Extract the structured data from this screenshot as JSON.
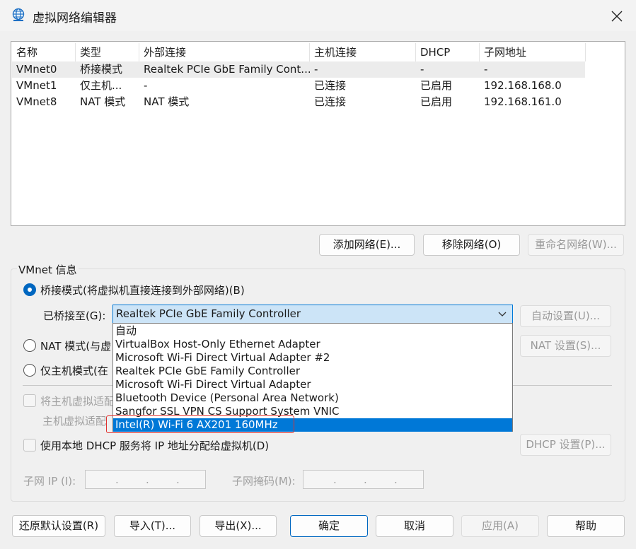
{
  "window": {
    "title": "虚拟网络编辑器",
    "icon": "globe-network-icon",
    "close_icon": "close-icon"
  },
  "network_list": {
    "columns": [
      "名称",
      "类型",
      "外部连接",
      "主机连接",
      "DHCP",
      "子网地址"
    ],
    "rows": [
      {
        "name": "VMnet0",
        "type": "桥接模式",
        "external": "Realtek PCIe GbE Family Cont...",
        "host": "-",
        "dhcp": "-",
        "subnet": "-"
      },
      {
        "name": "VMnet1",
        "type": "仅主机...",
        "external": "-",
        "host": "已连接",
        "dhcp": "已启用",
        "subnet": "192.168.168.0"
      },
      {
        "name": "VMnet8",
        "type": "NAT 模式",
        "external": "NAT 模式",
        "host": "已连接",
        "dhcp": "已启用",
        "subnet": "192.168.161.0"
      }
    ],
    "selected_row": 0
  },
  "list_buttons": {
    "add": "添加网络(E)...",
    "remove": "移除网络(O)",
    "rename": "重命名网络(W)..."
  },
  "vmnet_info": {
    "group_label": "VMnet 信息",
    "bridged_label": "桥接模式(将虚拟机直接连接到外部网络)(B)",
    "bridged_to_label": "已桥接至(G):",
    "bridged_to_value": "Realtek PCIe GbE Family Controller",
    "auto_settings": "自动设置(U)...",
    "nat_label": "NAT 模式(与虚",
    "nat_settings": "NAT 设置(S)...",
    "hostonly_label": "仅主机模式(在",
    "connect_adapter_label": "将主机虚拟适配",
    "adapter_name_label": "主机虚拟适配",
    "dhcp_label": "使用本地 DHCP 服务将 IP 地址分配给虚拟机(D)",
    "dhcp_settings": "DHCP 设置(P)...",
    "subnet_ip_label": "子网 IP (I):",
    "subnet_mask_label": "子网掩码(M):",
    "ip_dot": "."
  },
  "dropdown": {
    "options": [
      "自动",
      "VirtualBox Host-Only Ethernet Adapter",
      "Microsoft Wi-Fi Direct Virtual Adapter #2",
      "Realtek PCIe GbE Family Controller",
      "Microsoft Wi-Fi Direct Virtual Adapter",
      "Bluetooth Device (Personal Area Network)",
      "Sangfor SSL VPN CS Support System VNIC",
      "Intel(R) Wi-Fi 6 AX201 160MHz"
    ],
    "highlighted_index": 7,
    "arrow_icon": "chevron-down-icon"
  },
  "footer": {
    "restore": "还原默认设置(R)",
    "import": "导入(T)...",
    "export": "导出(X)...",
    "ok": "确定",
    "cancel": "取消",
    "apply": "应用(A)",
    "help": "帮助"
  },
  "colors": {
    "accent": "#0078d7",
    "highlight_box": "#e0302d"
  }
}
